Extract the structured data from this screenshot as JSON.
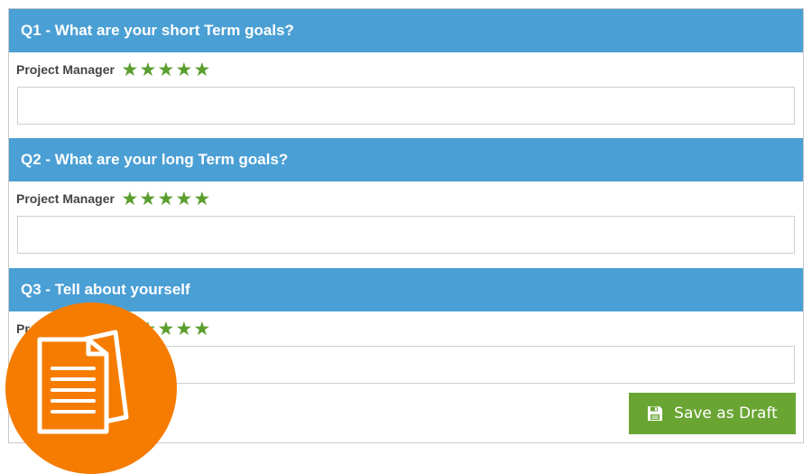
{
  "questions": [
    {
      "title": "Q1 - What are your short Term goals?",
      "role": "Project Manager",
      "rating": 5,
      "answer": ""
    },
    {
      "title": "Q2 - What are your long Term goals?",
      "role": "Project Manager",
      "rating": 5,
      "answer": ""
    },
    {
      "title": "Q3 - Tell about yourself",
      "role": "Project Manager",
      "rating": 5,
      "answer": ""
    }
  ],
  "actions": {
    "save_draft_label": "Save as Draft",
    "save_icon": "floppy-disk-icon"
  },
  "badge": {
    "icon": "documents-icon"
  },
  "colors": {
    "header_bg": "#4a9fd4",
    "star": "#5a9e2e",
    "button_bg": "#6aa533",
    "badge_bg": "#f57c00"
  }
}
